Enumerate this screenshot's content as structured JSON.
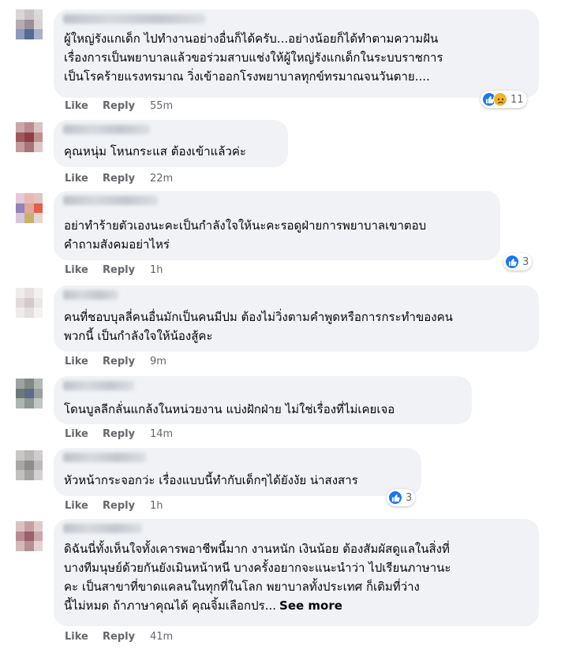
{
  "actions": {
    "like": "Like",
    "reply": "Reply"
  },
  "icons": {
    "like": "like-reaction-icon",
    "sad": "sad-reaction-icon"
  },
  "colors": {
    "like_blue": "#1877f2",
    "sad_yellow": "#f7b125",
    "bubble_bg": "#f0f2f5",
    "meta_gray": "#65676b"
  },
  "comments": [
    {
      "lines": [
        "ผู้ใหญ่รังแกเด็ก ไปทำงานอย่างอื่นก็ได้ครับ...อย่างน้อยก็ได้ทำตามความฝัน",
        "เรื่องการเป็นพยาบาลแล้วขอร่วมสาบแช่งให้ผู้ใหญ่รังแกเด็กในระบบราชการ",
        "เป็นโรคร้ายแรงทรมาณ วิ่งเข้าออกโรงพยาบาลทุกข์ทรมาณจนวันตาย...."
      ],
      "time": "55m",
      "reactions": "11"
    },
    {
      "lines": [
        "คุณหนุ่ม โหนกระแส ต้องเข้าแล้วค่ะ"
      ],
      "time": "22m"
    },
    {
      "lines": [
        "อย่าทำร้ายตัวเองนะคะเป็นกำลังใจให้นะคะรอดูฝ่ายการพยาบาลเขาตอบ",
        "คำถามสังคมอย่าไหร่"
      ],
      "time": "1h",
      "reactions": "3"
    },
    {
      "lines": [
        "คนที่ชอบบุลลี่คนอื่นมักเป็นคนมีปม ต้องไม่วิ่งตามคำพูดหรือการกระทำของคน",
        "พวกนี้ เป็นกำลังใจให้น้องสู้คะ"
      ],
      "time": "9m"
    },
    {
      "lines": [
        "โดนบูลลีกลั่นแกล้งในหน่วยงาน แบ่งฝักฝ่าย ไม่ใช่เรื่องที่ไม่เคยเจอ"
      ],
      "time": "14m"
    },
    {
      "lines": [
        "หัวหน้ากระจอกว่ะ เรื่องแบบนี้ทำกับเด็กๆได้ยังงัย น่าสงสาร"
      ],
      "time": "1h",
      "reactions": "3"
    },
    {
      "lines": [
        "ดิฉันนี่ทั้งเห็นใจทั้งเคารพอาชีพนี้มาก งานหนัก เงินน้อย ต้องสัมผัสดูแลในสิ่งที่",
        "บางทีมนุษย์ด้วยกันยังเมินหน้าหนี บางครั้งอยากจะแนะนำว่า ไปเรียนภาษานะ",
        "คะ เป็นสาขาที่ขาดแคลนในทุกที่ในโลก พยาบาลทั้งประเทศ ก็เติมที่ว่าง",
        "นี้ไม่หมด ถ้าภาษาคุณได้ คุณจิ้มเลือกปร..."
      ],
      "see_more": "See more",
      "time": "41m"
    }
  ]
}
